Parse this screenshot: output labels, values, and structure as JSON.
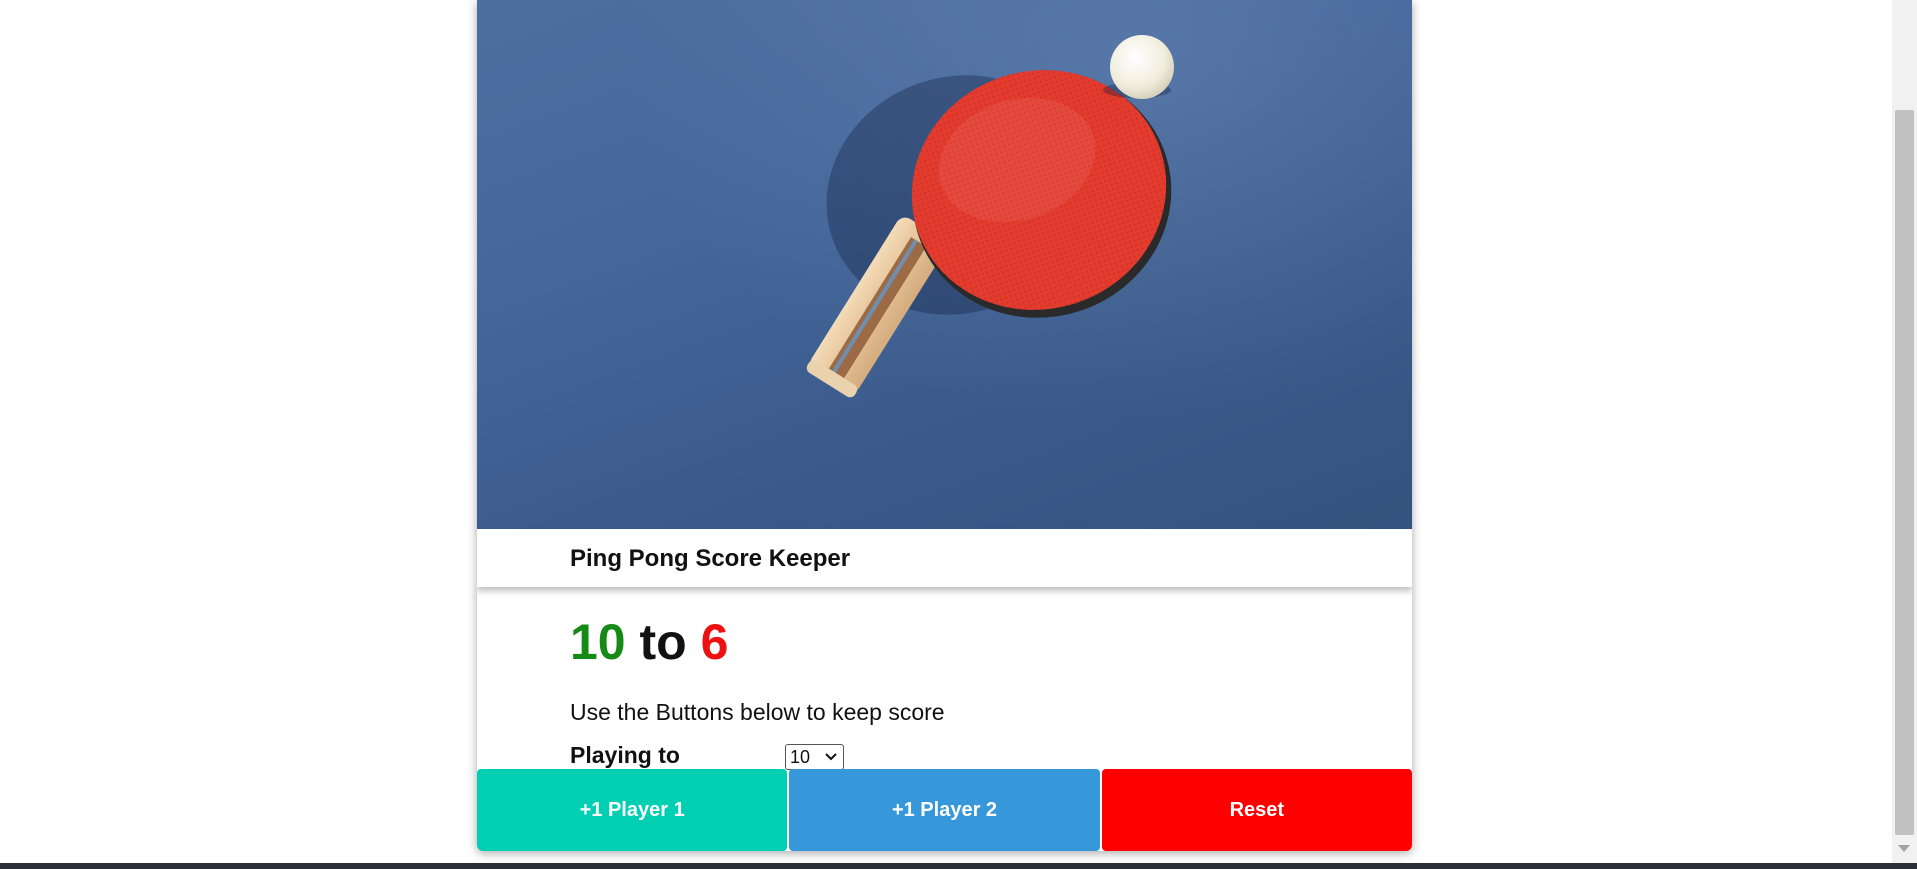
{
  "header": {
    "title": "Ping Pong Score Keeper"
  },
  "hero": {
    "image_subject": "ping-pong-paddle-and-ball",
    "colors": {
      "table": "#44669a",
      "paddle_rubber": "#e03a2f",
      "handle": "#e8c9a0",
      "ball": "#f4f1e6"
    }
  },
  "score": {
    "player1": "10",
    "separator": "to",
    "player2": "6",
    "player1_color": "#168a16",
    "player2_color": "#ee1111"
  },
  "instructions": "Use the Buttons below to keep score",
  "playing_to": {
    "label": "Playing to",
    "selected": "10"
  },
  "buttons": {
    "player1": "+1 Player 1",
    "player2": "+1 Player 2",
    "reset": "Reset"
  },
  "colors": {
    "player1_button": "#00cfb4",
    "player2_button": "#3698db",
    "reset_button": "#ff0000"
  }
}
